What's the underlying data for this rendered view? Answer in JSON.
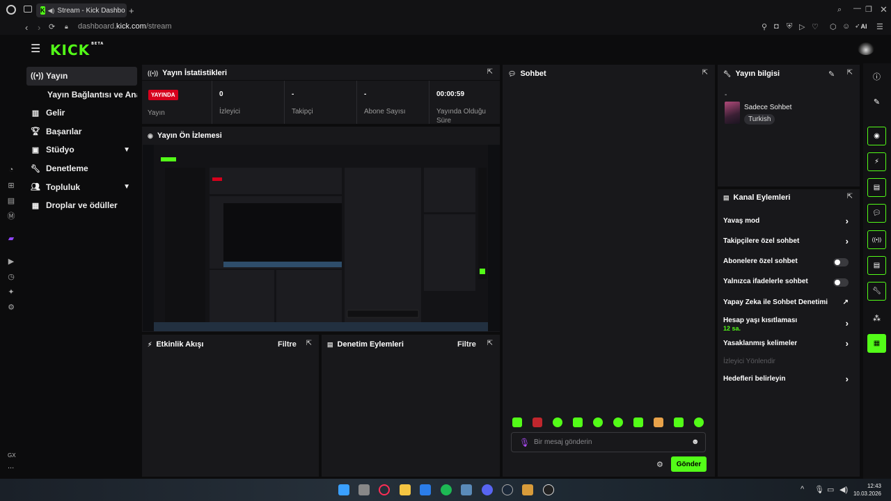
{
  "browser": {
    "tab_title": "Stream - Kick Dashbo",
    "favicon_letter": "K",
    "url_prefix": "dashboard.",
    "url_domain": "kick.com",
    "url_path": "/stream",
    "ai_label": "AI"
  },
  "kick": {
    "logo": "KICK",
    "beta": "BETA"
  },
  "sidebar": {
    "items": [
      {
        "label": "Yayın",
        "icon": "broadcast-icon"
      },
      {
        "label": "Yayın Bağlantısı ve Anahtarı",
        "icon": ""
      },
      {
        "label": "Gelir",
        "icon": "chart-icon"
      },
      {
        "label": "Başarılar",
        "icon": "trophy-icon"
      },
      {
        "label": "Stüdyo",
        "icon": "studio-icon"
      },
      {
        "label": "Denetleme",
        "icon": "wrench-icon"
      },
      {
        "label": "Topluluk",
        "icon": "people-icon"
      },
      {
        "label": "Droplar ve ödüller",
        "icon": "gift-icon"
      }
    ]
  },
  "left_rail": {
    "bottom_label": "GX",
    "more_label": "..."
  },
  "stats_panel": {
    "title": "Yayın İstatistikleri",
    "live_badge": "YAYINDA",
    "items": [
      {
        "value": "",
        "label": "Yayın"
      },
      {
        "value": "0",
        "label": "İzleyici"
      },
      {
        "value": "-",
        "label": "Takipçi"
      },
      {
        "value": "-",
        "label": "Abone Sayısı"
      },
      {
        "value": "00:00:59",
        "label": "Yayında Olduğu Süre"
      }
    ]
  },
  "preview_panel": {
    "title": "Yayın Ön İzlemesi"
  },
  "activity_panel": {
    "title": "Etkinlik Akışı",
    "filter": "Filtre"
  },
  "moderation_panel": {
    "title": "Denetim Eylemleri",
    "filter": "Filtre"
  },
  "chat_panel": {
    "title": "Sohbet",
    "placeholder": "Bir mesaj gönderin",
    "send_label": "Gönder"
  },
  "stream_info": {
    "title": "Yayın bilgisi",
    "dash": "-",
    "category": "Sadece Sohbet",
    "tag": "Turkish"
  },
  "channel_actions": {
    "title": "Kanal Eylemleri",
    "items": [
      {
        "label": "Yavaş mod",
        "control": "chevron"
      },
      {
        "label": "Takipçilere özel sohbet",
        "control": "chevron"
      },
      {
        "label": "Abonelere özel sohbet",
        "control": "toggle"
      },
      {
        "label": "Yalnızca ifadelerle sohbet",
        "control": "toggle"
      },
      {
        "label": "Yapay Zeka ile Sohbet Denetimi",
        "control": "external"
      },
      {
        "label": "Hesap yaşı kısıtlaması",
        "sub": "12 sa.",
        "control": "chevron"
      },
      {
        "label": "Yasaklanmış kelimeler",
        "control": "chevron"
      },
      {
        "label": "İzleyici Yönlendir",
        "control": "none",
        "disabled": true
      },
      {
        "label": "Hedefleri belirleyin",
        "control": "chevron"
      }
    ]
  },
  "taskbar": {
    "time": "12:43",
    "date": "10.03.2026"
  },
  "colors": {
    "brand": "#53fc18",
    "live": "#d6001c",
    "panel": "#18181b"
  }
}
